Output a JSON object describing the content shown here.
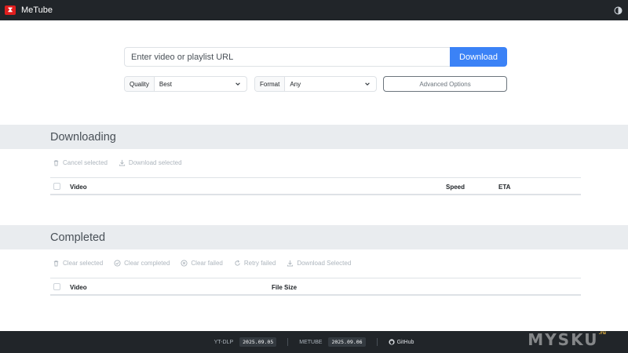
{
  "navbar": {
    "brand": "MeTube",
    "logo_glyph": "⧗"
  },
  "form": {
    "url_placeholder": "Enter video or playlist URL",
    "url_value": "",
    "download_label": "Download",
    "quality_label": "Quality",
    "quality_value": "Best",
    "format_label": "Format",
    "format_value": "Any",
    "advanced_label": "Advanced Options"
  },
  "downloading": {
    "title": "Downloading",
    "actions": {
      "cancel_selected": "Cancel selected",
      "download_selected": "Download selected"
    },
    "columns": {
      "video": "Video",
      "speed": "Speed",
      "eta": "ETA"
    }
  },
  "completed": {
    "title": "Completed",
    "actions": {
      "clear_selected": "Clear selected",
      "clear_completed": "Clear completed",
      "clear_failed": "Clear failed",
      "retry_failed": "Retry failed",
      "download_selected": "Download Selected"
    },
    "columns": {
      "video": "Video",
      "file_size": "File Size"
    }
  },
  "footer": {
    "ytdlp_label": "YT-DLP",
    "ytdlp_version": "2025.09.05",
    "metube_label": "METUBE",
    "metube_version": "2025.09.06",
    "github_label": "GitHub"
  },
  "watermark": {
    "text": "MYSKU",
    "suffix": ".ru"
  },
  "colors": {
    "accent": "#3b82f6",
    "navbar": "#212529",
    "section_bar": "#e9ecef"
  }
}
